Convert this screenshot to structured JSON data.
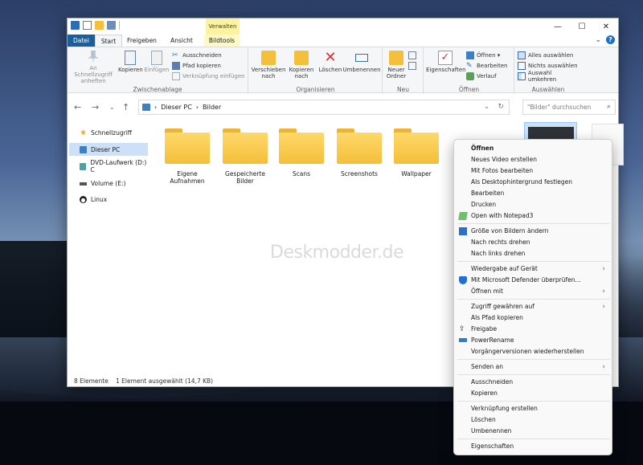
{
  "window": {
    "manage_tab": "Verwalten",
    "controls": {
      "minimize": "—",
      "maximize": "☐",
      "close": "✕"
    }
  },
  "tabs": {
    "file": "Datei",
    "start": "Start",
    "share": "Freigeben",
    "view": "Ansicht",
    "image_tools": "Bildtools",
    "collapse": "⌄",
    "help": "?"
  },
  "ribbon": {
    "clipboard": {
      "label": "Zwischenablage",
      "pin": "An Schnellzugriff anheften",
      "copy": "Kopieren",
      "paste": "Einfügen",
      "cut": "Ausschneiden",
      "copy_path": "Pfad kopieren",
      "paste_shortcut": "Verknüpfung einfügen"
    },
    "organize": {
      "label": "Organisieren",
      "move_to": "Verschieben nach",
      "copy_to": "Kopieren nach",
      "delete": "Löschen",
      "rename": "Umbenennen"
    },
    "new": {
      "label": "Neu",
      "new_folder": "Neuer Ordner"
    },
    "open": {
      "label": "Öffnen",
      "properties": "Eigenschaften",
      "open": "Öffnen ▾",
      "edit": "Bearbeiten",
      "history": "Verlauf"
    },
    "select": {
      "label": "Auswählen",
      "select_all": "Alles auswählen",
      "select_none": "Nichts auswählen",
      "invert": "Auswahl umkehren"
    }
  },
  "address": {
    "back": "←",
    "forward": "→",
    "recent": "⌄",
    "up": "↑",
    "path": [
      "Dieser PC",
      "Bilder"
    ],
    "sep": "›",
    "dropdown": "⌄",
    "refresh": "↻",
    "search_placeholder": "\"Bilder\" durchsuchen",
    "search_icon": "⌕"
  },
  "nav": {
    "items": [
      {
        "label": "Schnellzugriff",
        "icon": "star-icon"
      },
      {
        "label": "Dieser PC",
        "icon": "pc-icon"
      },
      {
        "label": "DVD-Laufwerk (D:) C",
        "icon": "dvd-icon"
      },
      {
        "label": "Volume (E:)",
        "icon": "drive-icon"
      },
      {
        "label": "Linux",
        "icon": "penguin-icon"
      }
    ]
  },
  "folders": [
    {
      "label": "Eigene Aufnahmen"
    },
    {
      "label": "Gespeicherte Bilder"
    },
    {
      "label": "Scans"
    },
    {
      "label": "Screenshots"
    },
    {
      "label": "Wallpaper"
    }
  ],
  "watermark": "Deskmodder.de",
  "status": {
    "count": "8 Elemente",
    "selection": "1 Element ausgewählt (14,7 KB)"
  },
  "context_menu": {
    "items": [
      {
        "label": "Öffnen",
        "bold": true
      },
      {
        "label": "Neues Video erstellen"
      },
      {
        "label": "Mit Fotos bearbeiten"
      },
      {
        "label": "Als Desktophintergrund festlegen"
      },
      {
        "label": "Bearbeiten"
      },
      {
        "label": "Drucken"
      },
      {
        "label": "Open with Notepad3"
      },
      {
        "label": "Größe von Bildern ändern"
      },
      {
        "label": "Nach rechts drehen"
      },
      {
        "label": "Nach links drehen"
      },
      {
        "label": "Wiedergabe auf Gerät"
      },
      {
        "label": "Mit Microsoft Defender überprüfen..."
      },
      {
        "label": "Öffnen mit"
      },
      {
        "label": "Zugriff gewähren auf"
      },
      {
        "label": "Als Pfad kopieren"
      },
      {
        "label": "Freigabe"
      },
      {
        "label": "PowerRename"
      },
      {
        "label": "Vorgängerversionen wiederherstellen"
      },
      {
        "label": "Senden an"
      },
      {
        "label": "Ausschneiden"
      },
      {
        "label": "Kopieren"
      },
      {
        "label": "Verknüpfung erstellen"
      },
      {
        "label": "Löschen"
      },
      {
        "label": "Umbenennen"
      },
      {
        "label": "Eigenschaften"
      }
    ],
    "submenu_arrow": "›"
  },
  "colors": {
    "accent": "#1a5e9c",
    "selection": "#cce1f7",
    "folder": "#f4bf3a",
    "manage_tab": "#fbf2a3"
  }
}
